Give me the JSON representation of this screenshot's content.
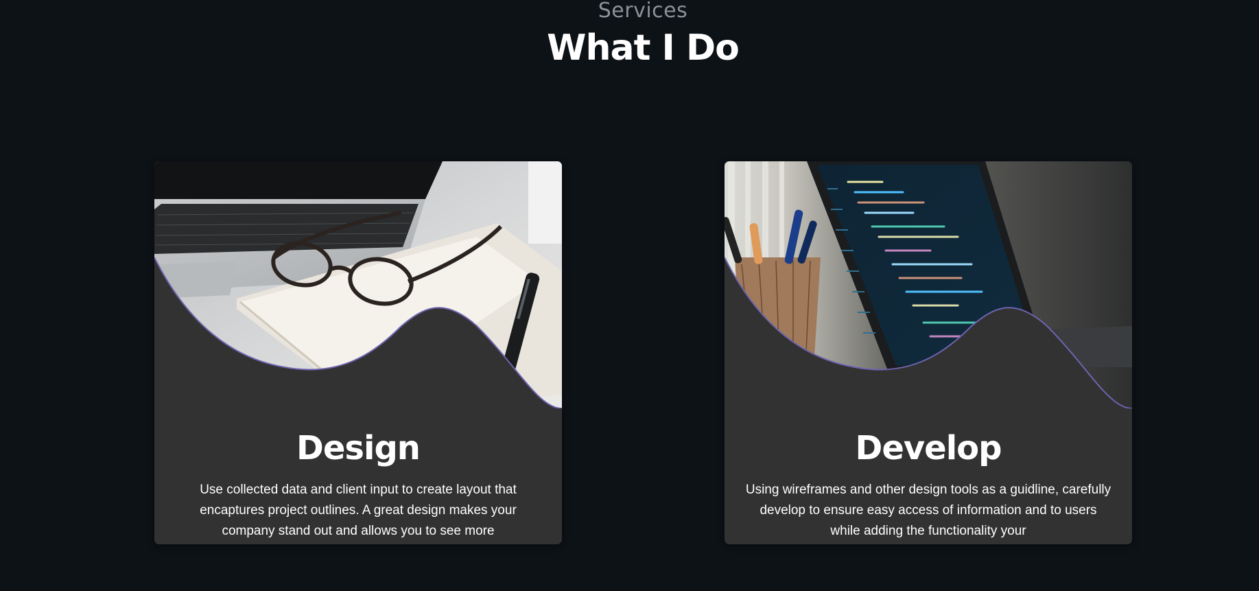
{
  "header": {
    "eyebrow": "Services",
    "title": "What I Do"
  },
  "cards": [
    {
      "title": "Design",
      "text": "Use collected data and client input to create layout that encaptures project outlines. A great design makes your company stand out and allows you to see more",
      "image": "laptop-glasses-notebook-photo"
    },
    {
      "title": "Develop",
      "text": "Using wireframes and other design tools as a guidline, carefully develop to ensure easy access of information and to users while adding the functionality your",
      "image": "code-laptop-pencil-cup-photo"
    }
  ],
  "colors": {
    "page_bg": "#0d1217",
    "card_bg": "#323232",
    "wave_stroke": "#6d64b0",
    "eyebrow": "#8c9197",
    "text": "#ffffff"
  }
}
